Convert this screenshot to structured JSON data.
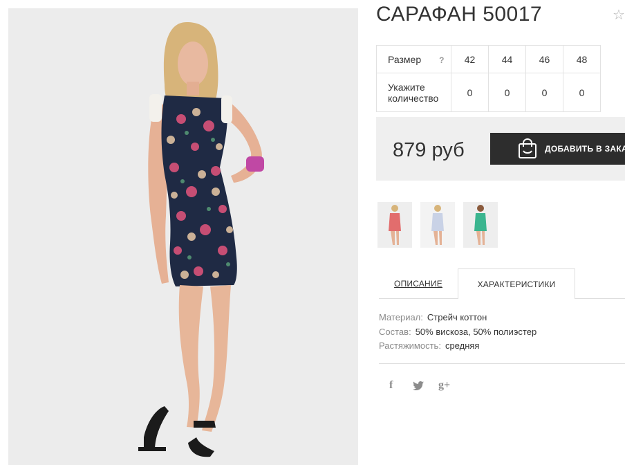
{
  "product": {
    "title": "САРАФАН 50017",
    "favorite_icon": "star-outline-icon"
  },
  "sizes": {
    "size_label": "Размер",
    "help": "?",
    "qty_label": "Укажите количество",
    "columns": [
      {
        "size": "42",
        "qty": "0"
      },
      {
        "size": "44",
        "qty": "0"
      },
      {
        "size": "46",
        "qty": "0"
      },
      {
        "size": "48",
        "qty": "0"
      }
    ]
  },
  "purchase": {
    "price": "879 руб",
    "add_button_label": "ДОБАВИТЬ В ЗАКАЗ",
    "button_icon": "shopping-bag-icon"
  },
  "tabs": [
    {
      "label": "ОПИСАНИЕ",
      "active": false
    },
    {
      "label": "ХАРАКТЕРИСТИКИ",
      "active": true
    }
  ],
  "characteristics": [
    {
      "key": "Материал:",
      "value": "Стрейч коттон"
    },
    {
      "key": "Состав:",
      "value": "50% вискоза, 50% полиэстер"
    },
    {
      "key": "Растяжимость:",
      "value": "средняя"
    }
  ],
  "social": [
    {
      "icon": "facebook-icon",
      "glyph": "f"
    },
    {
      "icon": "twitter-icon",
      "glyph": ""
    },
    {
      "icon": "google-plus-icon",
      "glyph": "g+"
    }
  ],
  "colors": {
    "dress_main": "#1f2a44",
    "variant_1": "#e26d6d",
    "variant_2": "#c9d2e6",
    "variant_3": "#3bb58f",
    "button_bg": "#2d2d2d",
    "price_bg": "#efefef"
  }
}
